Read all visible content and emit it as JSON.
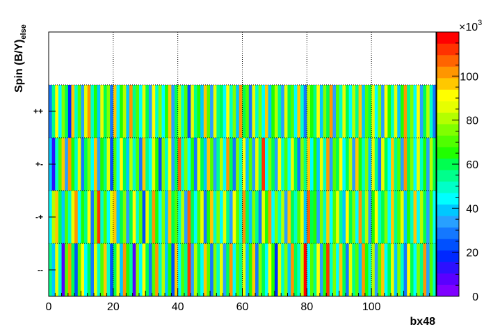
{
  "chart_data": {
    "type": "heatmap",
    "xlabel": "bx48",
    "ylabel_main": "Spin (B/Y)",
    "ylabel_sub": "else",
    "x_range": [
      0,
      120
    ],
    "x_bins": 120,
    "x_ticks": [
      0,
      20,
      40,
      60,
      80,
      100
    ],
    "y_categories": [
      "--",
      "-+",
      "+-",
      "++",
      "else"
    ],
    "y_tick_labels": [
      "--",
      "-+",
      "+-",
      "++"
    ],
    "z_range": [
      0,
      120000
    ],
    "z_scale_label": "×10",
    "z_scale_exponent": "3",
    "z_ticks": [
      0,
      20,
      40,
      60,
      80,
      100
    ],
    "grid": true,
    "palette": [
      "#7f00ff",
      "#5a00ff",
      "#2d10ff",
      "#0028ff",
      "#0050ff",
      "#1478ff",
      "#28a0ff",
      "#00c8ff",
      "#00ffff",
      "#00ffc8",
      "#00ff8c",
      "#00ff50",
      "#20ff00",
      "#50ff00",
      "#80ff00",
      "#b4ff00",
      "#e6ff00",
      "#ffff00",
      "#ffc800",
      "#ff9600",
      "#ff6400",
      "#ff3200",
      "#ff0000"
    ],
    "rows": [
      {
        "category": "--",
        "values": [
          56,
          38,
          88,
          52,
          6,
          68,
          104,
          58,
          26,
          70,
          92,
          44,
          62,
          30,
          84,
          50,
          72,
          96,
          48,
          24,
          60,
          86,
          40,
          102,
          66,
          54,
          8,
          76,
          44,
          90,
          58,
          28,
          70,
          100,
          52,
          80,
          38,
          64,
          22,
          94,
          46,
          72,
          56,
          110,
          34,
          82,
          60,
          42,
          98,
          68,
          28,
          74,
          50,
          88,
          36,
          62,
          104,
          46,
          70,
          56,
          84,
          40,
          66,
          96,
          30,
          78,
          58,
          44,
          92,
          64,
          20,
          86,
          52,
          74,
          38,
          100,
          60,
          48,
          82,
          116,
          44,
          70,
          56,
          90,
          34,
          66,
          112,
          50,
          78,
          42,
          94,
          60,
          28,
          84,
          54,
          72,
          38,
          102,
          64,
          50,
          80,
          36,
          68,
          96,
          46,
          58,
          88,
          40,
          74,
          52,
          30,
          92,
          62,
          46,
          78,
          56,
          100,
          36,
          70,
          48
        ]
      },
      {
        "category": "-+",
        "values": [
          44,
          80,
          94,
          60,
          38,
          72,
          50,
          88,
          104,
          42,
          66,
          56,
          90,
          30,
          76,
          112,
          52,
          68,
          46,
          84,
          98,
          40,
          62,
          74,
          36,
          58,
          92,
          48,
          70,
          26,
          86,
          54,
          100,
          64,
          44,
          78,
          38,
          96,
          58,
          68,
          50,
          82,
          34,
          106,
          60,
          46,
          72,
          88,
          30,
          64,
          98,
          52,
          76,
          42,
          84,
          56,
          36,
          92,
          70,
          48,
          104,
          62,
          40,
          78,
          56,
          30,
          88,
          66,
          100,
          44,
          74,
          52,
          82,
          36,
          94,
          60,
          48,
          70,
          86,
          40,
          108,
          58,
          64,
          32,
          78,
          50,
          96,
          44,
          68,
          84,
          56,
          38,
          90,
          62,
          74,
          46,
          102,
          54,
          80,
          34,
          66,
          92,
          48,
          60,
          76,
          42,
          98,
          56,
          70,
          86,
          38,
          64,
          52,
          94,
          44,
          80,
          58,
          36,
          72,
          46
        ]
      },
      {
        "category": "+-",
        "values": [
          40,
          14,
          52,
          70,
          94,
          32,
          100,
          64,
          48,
          84,
          28,
          58,
          76,
          44,
          96,
          36,
          66,
          54,
          88,
          24,
          72,
          46,
          92,
          60,
          38,
          80,
          50,
          68,
          30,
          98,
          56,
          42,
          84,
          64,
          26,
          74,
          48,
          90,
          36,
          62,
          108,
          52,
          78,
          44,
          66,
          30,
          86,
          58,
          40,
          94,
          70,
          34,
          56,
          82,
          46,
          100,
          62,
          28,
          74,
          52,
          90,
          40,
          68,
          36,
          86,
          54,
          114,
          44,
          78,
          60,
          32,
          92,
          50,
          70,
          42,
          88,
          62,
          30,
          76,
          56,
          98,
          46,
          66,
          38,
          84,
          52,
          104,
          34,
          72,
          60,
          90,
          44,
          58,
          80,
          36,
          96,
          66,
          48,
          74,
          40,
          88,
          56,
          30,
          84,
          62,
          46,
          94,
          54,
          70,
          34,
          100,
          58,
          76,
          42,
          88,
          50,
          66,
          36,
          82,
          60
        ]
      },
      {
        "category": "++",
        "values": [
          30,
          56,
          90,
          42,
          78,
          62,
          20,
          96,
          48,
          70,
          36,
          84,
          104,
          52,
          66,
          40,
          88,
          58,
          74,
          28,
          94,
          46,
          64,
          82,
          38,
          100,
          54,
          70,
          44,
          86,
          60,
          32,
          92,
          50,
          76,
          42,
          66,
          98,
          36,
          58,
          80,
          48,
          72,
          26,
          88,
          54,
          64,
          40,
          96,
          70,
          34,
          84,
          56,
          62,
          44,
          90,
          50,
          76,
          38,
          102,
          58,
          68,
          30,
          86,
          52,
          74,
          46,
          94,
          40,
          64,
          80,
          56,
          34,
          88,
          62,
          72,
          44,
          98,
          50,
          30,
          82,
          66,
          54,
          92,
          40,
          76,
          58,
          100,
          36,
          68,
          48,
          86,
          62,
          42,
          80,
          54,
          96,
          38,
          70,
          58,
          88,
          46,
          74,
          32,
          92,
          64,
          50,
          84,
          40,
          66,
          104,
          56,
          76,
          44,
          90,
          34,
          60,
          80,
          48,
          30
        ]
      }
    ]
  }
}
